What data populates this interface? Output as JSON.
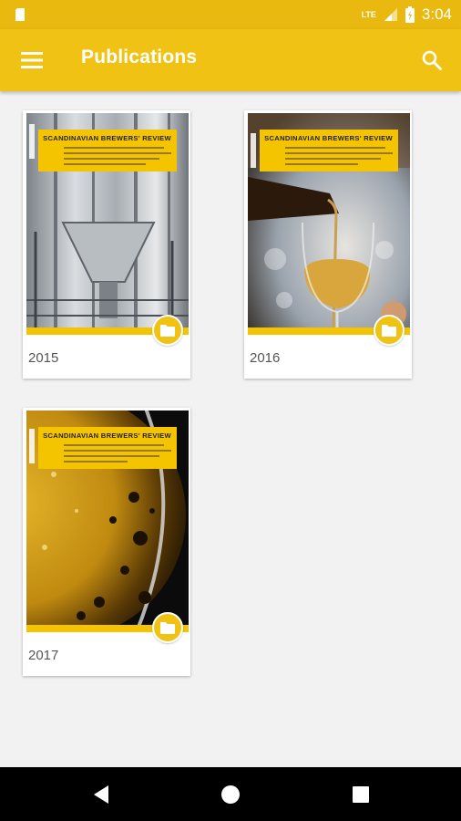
{
  "status_bar": {
    "network": "LTE",
    "time": "3:04",
    "icons": [
      "sd-card-icon",
      "signal-icon",
      "battery-icon"
    ]
  },
  "app_bar": {
    "title": "Publications",
    "menu_icon": "menu-icon",
    "search_icon": "search-icon"
  },
  "colors": {
    "accent": "#f0c214",
    "status_bar": "#e9b90f",
    "background": "#f2f2f2",
    "nav_bar": "#000000"
  },
  "publications": [
    {
      "year": "2015",
      "cover_title": "SCANDINAVIAN BREWERS' REVIEW",
      "action_icon": "folder-icon"
    },
    {
      "year": "2016",
      "cover_title": "SCANDINAVIAN BREWERS' REVIEW",
      "action_icon": "folder-icon"
    },
    {
      "year": "2017",
      "cover_title": "SCANDINAVIAN BREWERS' REVIEW",
      "action_icon": "folder-icon"
    }
  ],
  "nav_bar": {
    "icons": [
      "back-icon",
      "home-icon",
      "recents-icon"
    ]
  }
}
